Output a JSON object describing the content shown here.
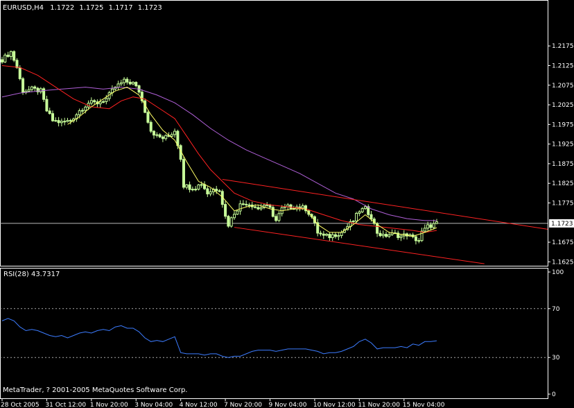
{
  "colors": {
    "background": "#000000",
    "frame": "#ffffff",
    "candle_bull": "#c8ff9a",
    "candle_bear": "#c8ff9a",
    "ma_fast": "#ffff66",
    "ma_mid": "#ff2222",
    "ma_slow": "#b060d8",
    "channel": "#ff2222",
    "rsi_line": "#3c7cff",
    "level_dotted": "#aaaaaa",
    "price_tag_bg": "#ffffff"
  },
  "chart_data": [
    {
      "type": "candlestick",
      "header": {
        "symbol": "EURUSD,H4",
        "open": "1.1722",
        "high": "1.1725",
        "low": "1.1717",
        "close": "1.1723"
      },
      "current_price_tag": "1.1723",
      "current_price": 1.1723,
      "ylim": [
        1.1615,
        1.2292
      ],
      "y_ticks": [
        {
          "value": 1.2175,
          "label": "1.2175"
        },
        {
          "value": 1.2125,
          "label": "1.2125"
        },
        {
          "value": 1.2075,
          "label": "1.2075"
        },
        {
          "value": 1.2025,
          "label": "1.2025"
        },
        {
          "value": 1.1975,
          "label": "1.1975"
        },
        {
          "value": 1.1925,
          "label": "1.1925"
        },
        {
          "value": 1.1875,
          "label": "1.1875"
        },
        {
          "value": 1.1825,
          "label": "1.1825"
        },
        {
          "value": 1.1775,
          "label": "1.1775"
        },
        {
          "value": 1.1675,
          "label": "1.1675"
        },
        {
          "value": 1.1625,
          "label": "1.1625"
        }
      ],
      "x_ticks": [
        {
          "index": 0,
          "label": "28 Oct 2005"
        },
        {
          "index": 15,
          "label": "31 Oct 12:00"
        },
        {
          "index": 30,
          "label": "1 Nov 20:00"
        },
        {
          "index": 45,
          "label": "3 Nov 04:00"
        },
        {
          "index": 60,
          "label": "4 Nov 12:00"
        },
        {
          "index": 75,
          "label": "7 Nov 20:00"
        },
        {
          "index": 90,
          "label": "9 Nov 04:00"
        },
        {
          "index": 105,
          "label": "10 Nov 12:00"
        },
        {
          "index": 120,
          "label": "11 Nov 20:00"
        },
        {
          "index": 135,
          "label": "15 Nov 04:00"
        }
      ],
      "x_count": 154,
      "close_path": [
        [
          0,
          1.214
        ],
        [
          3,
          1.216
        ],
        [
          5,
          1.212
        ],
        [
          7,
          1.206
        ],
        [
          10,
          1.2065
        ],
        [
          13,
          1.206
        ],
        [
          15,
          1.201
        ],
        [
          17,
          1.1985
        ],
        [
          20,
          1.198
        ],
        [
          23,
          1.1985
        ],
        [
          26,
          1.201
        ],
        [
          29,
          1.203
        ],
        [
          32,
          1.203
        ],
        [
          35,
          1.204
        ],
        [
          38,
          1.207
        ],
        [
          41,
          1.2085
        ],
        [
          44,
          1.208
        ],
        [
          46,
          1.206
        ],
        [
          48,
          1.201
        ],
        [
          50,
          1.196
        ],
        [
          52,
          1.1945
        ],
        [
          54,
          1.194
        ],
        [
          56,
          1.1945
        ],
        [
          58,
          1.196
        ],
        [
          60,
          1.189
        ],
        [
          61,
          1.182
        ],
        [
          63,
          1.1815
        ],
        [
          65,
          1.1815
        ],
        [
          67,
          1.1825
        ],
        [
          69,
          1.18
        ],
        [
          71,
          1.181
        ],
        [
          73,
          1.181
        ],
        [
          75,
          1.174
        ],
        [
          76,
          1.172
        ],
        [
          78,
          1.175
        ],
        [
          80,
          1.177
        ],
        [
          82,
          1.1775
        ],
        [
          84,
          1.177
        ],
        [
          86,
          1.176
        ],
        [
          88,
          1.177
        ],
        [
          90,
          1.176
        ],
        [
          92,
          1.173
        ],
        [
          94,
          1.176
        ],
        [
          96,
          1.1765
        ],
        [
          98,
          1.1765
        ],
        [
          100,
          1.1765
        ],
        [
          102,
          1.176
        ],
        [
          104,
          1.174
        ],
        [
          106,
          1.17
        ],
        [
          108,
          1.169
        ],
        [
          110,
          1.169
        ],
        [
          112,
          1.1695
        ],
        [
          114,
          1.17
        ],
        [
          116,
          1.1715
        ],
        [
          118,
          1.173
        ],
        [
          120,
          1.1755
        ],
        [
          122,
          1.176
        ],
        [
          124,
          1.174
        ],
        [
          126,
          1.17
        ],
        [
          128,
          1.169
        ],
        [
          130,
          1.1695
        ],
        [
          132,
          1.1695
        ],
        [
          134,
          1.169
        ],
        [
          136,
          1.1695
        ],
        [
          138,
          1.1685
        ],
        [
          140,
          1.168
        ],
        [
          141,
          1.17
        ],
        [
          143,
          1.1715
        ],
        [
          145,
          1.172
        ],
        [
          146,
          1.1723
        ]
      ],
      "ma_fast_path": [
        [
          22,
          1.1975
        ],
        [
          26,
          1.1995
        ],
        [
          30,
          1.202
        ],
        [
          34,
          1.204
        ],
        [
          38,
          1.206
        ],
        [
          42,
          1.207
        ],
        [
          46,
          1.205
        ],
        [
          50,
          1.2
        ],
        [
          54,
          1.196
        ],
        [
          58,
          1.1935
        ],
        [
          62,
          1.188
        ],
        [
          66,
          1.183
        ],
        [
          70,
          1.1815
        ],
        [
          74,
          1.179
        ],
        [
          78,
          1.1755
        ],
        [
          82,
          1.1765
        ],
        [
          86,
          1.177
        ],
        [
          90,
          1.176
        ],
        [
          94,
          1.1755
        ],
        [
          98,
          1.176
        ],
        [
          102,
          1.176
        ],
        [
          106,
          1.172
        ],
        [
          110,
          1.17
        ],
        [
          114,
          1.17
        ],
        [
          118,
          1.172
        ],
        [
          122,
          1.1745
        ],
        [
          126,
          1.172
        ],
        [
          130,
          1.17
        ],
        [
          134,
          1.1695
        ],
        [
          138,
          1.169
        ],
        [
          142,
          1.17
        ],
        [
          146,
          1.1712
        ]
      ],
      "ma_mid_path": [
        [
          0,
          1.2125
        ],
        [
          6,
          1.212
        ],
        [
          12,
          1.21
        ],
        [
          18,
          1.207
        ],
        [
          24,
          1.204
        ],
        [
          30,
          1.202
        ],
        [
          36,
          1.2015
        ],
        [
          40,
          1.2035
        ],
        [
          44,
          1.2045
        ],
        [
          48,
          1.204
        ],
        [
          54,
          1.201
        ],
        [
          58,
          1.199
        ],
        [
          62,
          1.1945
        ],
        [
          66,
          1.19
        ],
        [
          70,
          1.186
        ],
        [
          74,
          1.183
        ],
        [
          78,
          1.18
        ],
        [
          84,
          1.178
        ],
        [
          90,
          1.177
        ],
        [
          96,
          1.1765
        ],
        [
          102,
          1.176
        ],
        [
          108,
          1.1745
        ],
        [
          114,
          1.173
        ],
        [
          120,
          1.172
        ],
        [
          126,
          1.1715
        ],
        [
          132,
          1.171
        ],
        [
          138,
          1.1705
        ],
        [
          142,
          1.17
        ],
        [
          146,
          1.1705
        ]
      ],
      "ma_slow_path": [
        [
          0,
          1.2045
        ],
        [
          6,
          1.2055
        ],
        [
          12,
          1.206
        ],
        [
          20,
          1.2065
        ],
        [
          28,
          1.207
        ],
        [
          34,
          1.2065
        ],
        [
          40,
          1.207
        ],
        [
          46,
          1.2065
        ],
        [
          52,
          1.205
        ],
        [
          58,
          1.203
        ],
        [
          64,
          1.2
        ],
        [
          70,
          1.1965
        ],
        [
          76,
          1.1935
        ],
        [
          82,
          1.191
        ],
        [
          88,
          1.189
        ],
        [
          94,
          1.187
        ],
        [
          100,
          1.185
        ],
        [
          106,
          1.1825
        ],
        [
          112,
          1.18
        ],
        [
          118,
          1.1785
        ],
        [
          124,
          1.176
        ],
        [
          130,
          1.1745
        ],
        [
          136,
          1.1735
        ],
        [
          142,
          1.173
        ],
        [
          146,
          1.173
        ]
      ],
      "channel_lines": [
        {
          "from": [
            74,
            1.1835
          ],
          "to": [
            188,
            1.1708
          ]
        },
        {
          "from": [
            78,
            1.1713
          ],
          "to": [
            162,
            1.162
          ]
        }
      ]
    },
    {
      "type": "line",
      "label": "RSI(28) 43.7317",
      "ylim": [
        0,
        100
      ],
      "y_ticks": [
        {
          "value": 100,
          "label": "100"
        },
        {
          "value": 70,
          "label": "70"
        },
        {
          "value": 30,
          "label": "30"
        },
        {
          "value": 0,
          "label": "0"
        }
      ],
      "levels": [
        70,
        30
      ],
      "values": [
        [
          0,
          60
        ],
        [
          2,
          62
        ],
        [
          4,
          60
        ],
        [
          6,
          55
        ],
        [
          8,
          52
        ],
        [
          10,
          53
        ],
        [
          12,
          52
        ],
        [
          14,
          50
        ],
        [
          16,
          48
        ],
        [
          18,
          47
        ],
        [
          20,
          48
        ],
        [
          22,
          46
        ],
        [
          24,
          48
        ],
        [
          26,
          50
        ],
        [
          28,
          51
        ],
        [
          30,
          50
        ],
        [
          32,
          52
        ],
        [
          34,
          53
        ],
        [
          36,
          52
        ],
        [
          38,
          55
        ],
        [
          40,
          56
        ],
        [
          42,
          54
        ],
        [
          44,
          54
        ],
        [
          46,
          51
        ],
        [
          48,
          46
        ],
        [
          50,
          43
        ],
        [
          52,
          44
        ],
        [
          54,
          43
        ],
        [
          56,
          45
        ],
        [
          58,
          47
        ],
        [
          60,
          34
        ],
        [
          62,
          33
        ],
        [
          64,
          33
        ],
        [
          66,
          33
        ],
        [
          68,
          32
        ],
        [
          70,
          33
        ],
        [
          72,
          33
        ],
        [
          74,
          31
        ],
        [
          76,
          30
        ],
        [
          78,
          31
        ],
        [
          80,
          31
        ],
        [
          82,
          33
        ],
        [
          84,
          35
        ],
        [
          86,
          36
        ],
        [
          88,
          36
        ],
        [
          90,
          36
        ],
        [
          92,
          35
        ],
        [
          94,
          36
        ],
        [
          96,
          37
        ],
        [
          98,
          37
        ],
        [
          100,
          37
        ],
        [
          102,
          37
        ],
        [
          104,
          36
        ],
        [
          106,
          35
        ],
        [
          108,
          33
        ],
        [
          110,
          34
        ],
        [
          112,
          34
        ],
        [
          114,
          35
        ],
        [
          116,
          37
        ],
        [
          118,
          39
        ],
        [
          120,
          43
        ],
        [
          122,
          45
        ],
        [
          124,
          42
        ],
        [
          126,
          37
        ],
        [
          128,
          38
        ],
        [
          130,
          38
        ],
        [
          132,
          38
        ],
        [
          134,
          39
        ],
        [
          136,
          38
        ],
        [
          138,
          41
        ],
        [
          140,
          40
        ],
        [
          142,
          43
        ],
        [
          144,
          43
        ],
        [
          146,
          43.7
        ]
      ]
    }
  ],
  "footer": {
    "copyright": "MetaTrader, ? 2001-2005 MetaQuotes Software Corp."
  }
}
